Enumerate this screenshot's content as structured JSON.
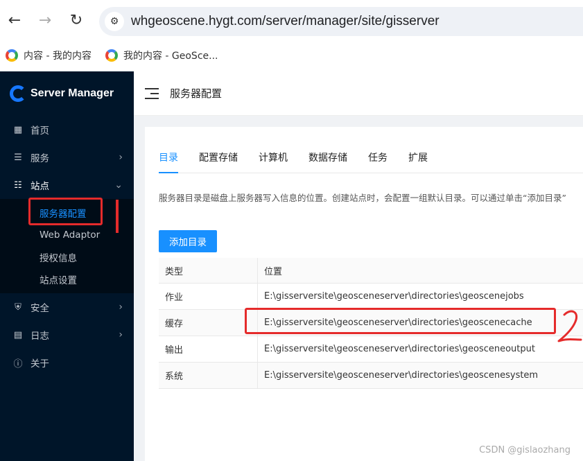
{
  "browser": {
    "url": "whgeoscene.hygt.com/server/manager/site/gisserver",
    "bookmarks": [
      "内容 - 我的内容",
      "我的内容 - GeoSce..."
    ]
  },
  "sidebar": {
    "brand": "Server Manager",
    "items": [
      {
        "label": "首页",
        "icon": "grid-icon"
      },
      {
        "label": "服务",
        "icon": "list-icon"
      },
      {
        "label": "站点",
        "icon": "sitemap-icon"
      },
      {
        "label": "安全",
        "icon": "shield-icon"
      },
      {
        "label": "日志",
        "icon": "log-icon"
      },
      {
        "label": "关于",
        "icon": "info-icon"
      }
    ],
    "subitems": [
      "服务器配置",
      "Web Adaptor",
      "授权信息",
      "站点设置"
    ]
  },
  "header": {
    "title": "服务器配置"
  },
  "tabs": [
    "目录",
    "配置存储",
    "计算机",
    "数据存储",
    "任务",
    "扩展"
  ],
  "description": "服务器目录是磁盘上服务器写入信息的位置。创建站点时，会配置一组默认目录。可以通过单击“添加目录”",
  "add_button": "添加目录",
  "table": {
    "headers": [
      "类型",
      "位置"
    ],
    "rows": [
      [
        "作业",
        "E:\\gisserversite\\geosceneserver\\directories\\geoscenejobs"
      ],
      [
        "缓存",
        "E:\\gisserversite\\geosceneserver\\directories\\geoscenecache"
      ],
      [
        "输出",
        "E:\\gisserversite\\geosceneserver\\directories\\geosceneoutput"
      ],
      [
        "系统",
        "E:\\gisserversite\\geosceneserver\\directories\\geoscenesystem"
      ]
    ]
  },
  "watermark": "CSDN @gislaozhang",
  "colors": {
    "accent": "#1890ff",
    "sidebar": "#001529",
    "annotation": "#e52b2b"
  }
}
